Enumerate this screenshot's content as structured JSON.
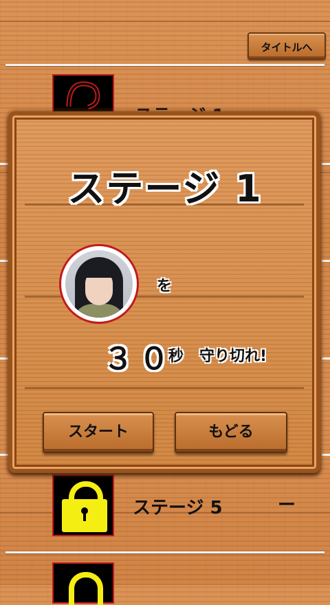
{
  "header": {
    "title_button_label": "タイトルへ"
  },
  "stage_list": [
    {
      "label": "ステージ 1",
      "locked": false,
      "time": ""
    },
    {
      "label": "ステージ 5",
      "locked": true,
      "time": "ー"
    }
  ],
  "dialog": {
    "title": "ステージ 1",
    "particle": "を",
    "seconds": "３０",
    "seconds_unit": "秒",
    "goal_text": "守り切れ!",
    "start_button": "スタート",
    "back_button": "もどる"
  },
  "colors": {
    "wood": "#d08443",
    "border_red": "#c21a1a",
    "lock_yellow": "#f5ee13"
  },
  "icons": {
    "locked": "padlock-icon",
    "unlocked": "question-mark-icon"
  }
}
